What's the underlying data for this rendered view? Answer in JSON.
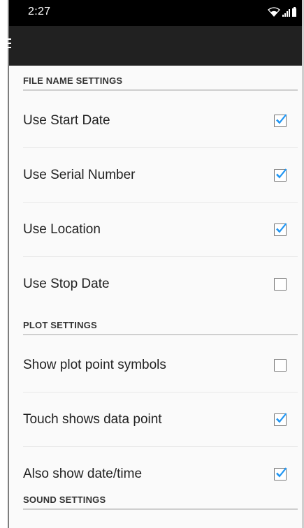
{
  "status_bar": {
    "time": "2:27"
  },
  "sections": [
    {
      "header": "FILE NAME SETTINGS",
      "items": [
        {
          "title": "Use Start Date",
          "checked": true
        },
        {
          "title": "Use Serial Number",
          "checked": true
        },
        {
          "title": "Use Location",
          "checked": true
        },
        {
          "title": "Use Stop Date",
          "checked": false
        }
      ]
    },
    {
      "header": "PLOT SETTINGS",
      "items": [
        {
          "title": "Show plot point symbols",
          "checked": false
        },
        {
          "title": "Touch shows data point",
          "checked": true
        },
        {
          "title": "Also show date/time",
          "checked": true
        }
      ]
    },
    {
      "header": "SOUND SETTINGS",
      "items": []
    }
  ],
  "colors": {
    "check_accent": "#2196f3",
    "app_bar": "#212121",
    "status_bar": "#000000"
  }
}
